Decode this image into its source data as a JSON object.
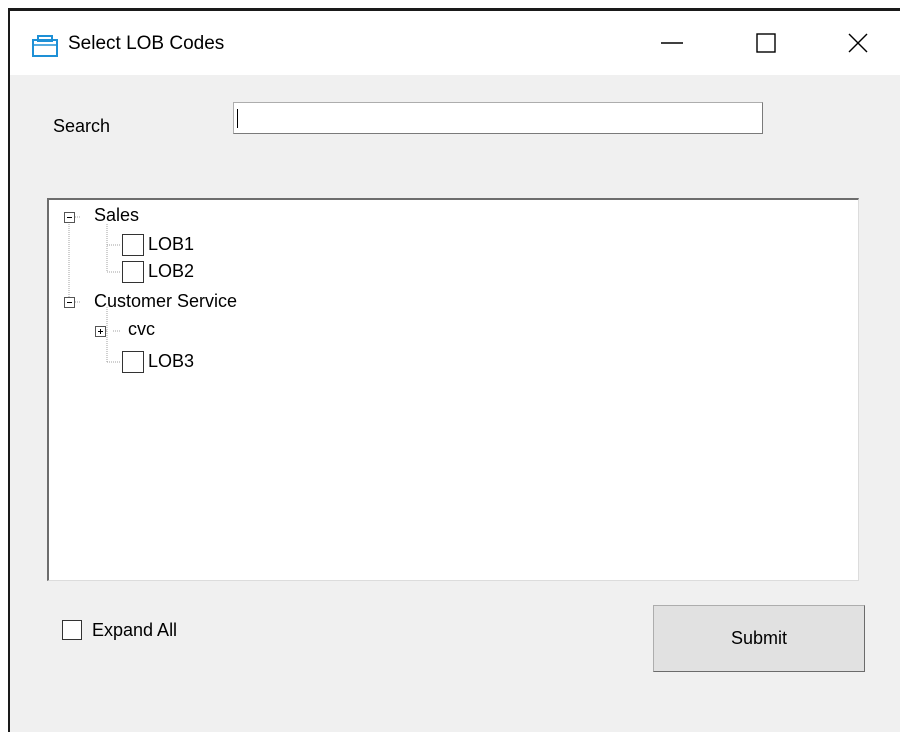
{
  "window": {
    "title": "Select LOB Codes",
    "icon": "window-icon",
    "accent_color": "#1e90d6",
    "controls": [
      "minimize-icon",
      "maximize-icon",
      "close-icon"
    ]
  },
  "search": {
    "label": "Search",
    "value": "",
    "placeholder": ""
  },
  "tree": {
    "nodes": [
      {
        "label": "Sales",
        "expanded": true,
        "children": [
          {
            "label": "LOB1",
            "checked": false
          },
          {
            "label": "LOB2",
            "checked": false
          }
        ]
      },
      {
        "label": "Customer Service",
        "expanded": true,
        "children": [
          {
            "label": "cvc",
            "expanded": false
          },
          {
            "label": "LOB3",
            "checked": false
          }
        ]
      }
    ]
  },
  "expand_all": {
    "label": "Expand All",
    "checked": false
  },
  "submit": {
    "label": "Submit"
  }
}
